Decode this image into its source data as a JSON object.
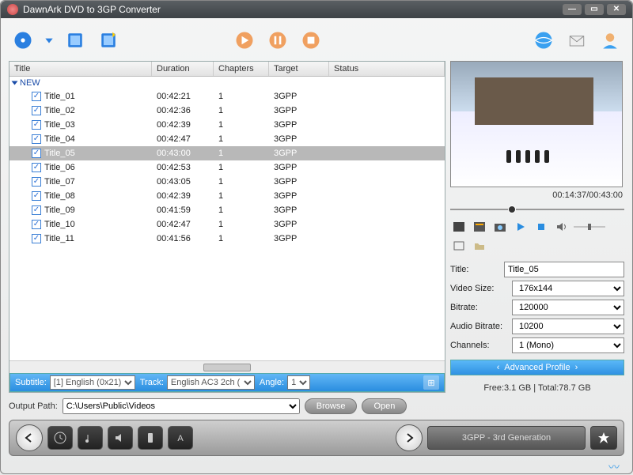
{
  "app": {
    "title": "DawnArk DVD to 3GP Converter"
  },
  "toolbar_icons": {
    "load_dvd": "load-dvd-icon",
    "add_chapter": "add-chapter-icon",
    "add_title": "add-title-icon",
    "convert": "convert-icon",
    "pause": "pause-convert-icon",
    "stop": "stop-convert-icon",
    "web": "globe-icon",
    "mail": "mail-icon",
    "user": "user-icon"
  },
  "columns": {
    "title": "Title",
    "duration": "Duration",
    "chapters": "Chapters",
    "target": "Target",
    "status": "Status"
  },
  "group": {
    "name": "NEW"
  },
  "rows": [
    {
      "checked": true,
      "title": "Title_01",
      "duration": "00:42:21",
      "chapters": "1",
      "target": "3GPP",
      "status": ""
    },
    {
      "checked": true,
      "title": "Title_02",
      "duration": "00:42:36",
      "chapters": "1",
      "target": "3GPP",
      "status": ""
    },
    {
      "checked": true,
      "title": "Title_03",
      "duration": "00:42:39",
      "chapters": "1",
      "target": "3GPP",
      "status": ""
    },
    {
      "checked": true,
      "title": "Title_04",
      "duration": "00:42:47",
      "chapters": "1",
      "target": "3GPP",
      "status": ""
    },
    {
      "checked": true,
      "title": "Title_05",
      "duration": "00:43:00",
      "chapters": "1",
      "target": "3GPP",
      "status": "",
      "selected": true
    },
    {
      "checked": true,
      "title": "Title_06",
      "duration": "00:42:53",
      "chapters": "1",
      "target": "3GPP",
      "status": ""
    },
    {
      "checked": true,
      "title": "Title_07",
      "duration": "00:43:05",
      "chapters": "1",
      "target": "3GPP",
      "status": ""
    },
    {
      "checked": true,
      "title": "Title_08",
      "duration": "00:42:39",
      "chapters": "1",
      "target": "3GPP",
      "status": ""
    },
    {
      "checked": true,
      "title": "Title_09",
      "duration": "00:41:59",
      "chapters": "1",
      "target": "3GPP",
      "status": ""
    },
    {
      "checked": true,
      "title": "Title_10",
      "duration": "00:42:47",
      "chapters": "1",
      "target": "3GPP",
      "status": ""
    },
    {
      "checked": true,
      "title": "Title_11",
      "duration": "00:41:56",
      "chapters": "1",
      "target": "3GPP",
      "status": ""
    }
  ],
  "subtitle": {
    "label": "Subtitle:",
    "value": "[1] English (0x21)"
  },
  "track": {
    "label": "Track:",
    "value": "English AC3 2ch ("
  },
  "angle": {
    "label": "Angle:",
    "value": "1"
  },
  "output": {
    "label": "Output Path:",
    "value": "C:\\Users\\Public\\Videos",
    "browse": "Browse",
    "open": "Open"
  },
  "preview": {
    "timestamp": "00:14:37/00:43:00"
  },
  "form": {
    "title": {
      "label": "Title:",
      "value": "Title_05"
    },
    "videosize": {
      "label": "Video Size:",
      "value": "176x144"
    },
    "bitrate": {
      "label": "Bitrate:",
      "value": "120000"
    },
    "audiobitrate": {
      "label": "Audio Bitrate:",
      "value": "10200"
    },
    "channels": {
      "label": "Channels:",
      "value": "1 (Mono)"
    }
  },
  "advanced": {
    "label": "Advanced Profile"
  },
  "disk": {
    "text": "Free:3.1 GB | Total:78.7 GB"
  },
  "bottombar": {
    "format": "3GPP - 3rd Generation"
  }
}
